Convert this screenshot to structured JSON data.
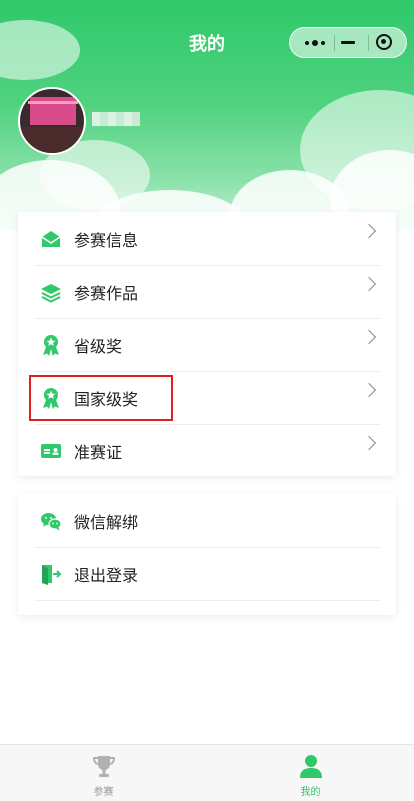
{
  "header": {
    "title": "我的"
  },
  "capsule": {
    "more_icon": "more-dots-icon",
    "minimize_icon": "minimize-icon",
    "close_icon": "target-close-icon"
  },
  "profile": {
    "avatar": "user-avatar-photo"
  },
  "menu_main": [
    {
      "label": "参赛信息",
      "icon": "envelope-icon"
    },
    {
      "label": "参赛作品",
      "icon": "layers-icon"
    },
    {
      "label": "省级奖",
      "icon": "award-ribbon-icon"
    },
    {
      "label": "国家级奖",
      "icon": "award-ribbon-icon"
    },
    {
      "label": "准赛证",
      "icon": "id-card-icon"
    }
  ],
  "menu_secondary": [
    {
      "label": "微信解绑",
      "icon": "wechat-icon"
    },
    {
      "label": "退出登录",
      "icon": "logout-door-icon"
    }
  ],
  "tabbar": [
    {
      "label": "参赛",
      "icon": "trophy-icon",
      "active": false
    },
    {
      "label": "我的",
      "icon": "person-icon",
      "active": true
    }
  ],
  "colors": {
    "accent": "#2fc86a",
    "active_tab": "#2fc86a",
    "inactive_tab": "#999999",
    "highlight_box": "#e02020"
  }
}
